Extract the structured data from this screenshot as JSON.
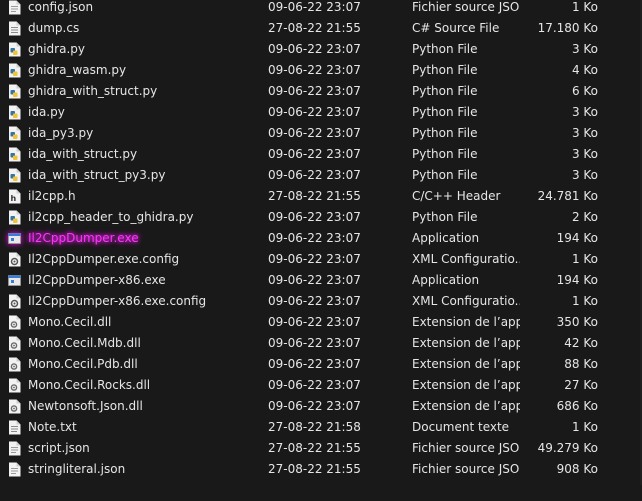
{
  "files": [
    {
      "name": "config.json",
      "date": "09-06-22 23:07",
      "type": "Fichier source JSON",
      "size": "1 Ko",
      "icon": "json-file-icon"
    },
    {
      "name": "dump.cs",
      "date": "27-08-22 21:55",
      "type": "C# Source File",
      "size": "17.180 Ko",
      "icon": "csharp-file-icon"
    },
    {
      "name": "ghidra.py",
      "date": "09-06-22 23:07",
      "type": "Python File",
      "size": "3 Ko",
      "icon": "python-file-icon"
    },
    {
      "name": "ghidra_wasm.py",
      "date": "09-06-22 23:07",
      "type": "Python File",
      "size": "4 Ko",
      "icon": "python-file-icon"
    },
    {
      "name": "ghidra_with_struct.py",
      "date": "09-06-22 23:07",
      "type": "Python File",
      "size": "6 Ko",
      "icon": "python-file-icon"
    },
    {
      "name": "ida.py",
      "date": "09-06-22 23:07",
      "type": "Python File",
      "size": "3 Ko",
      "icon": "python-file-icon"
    },
    {
      "name": "ida_py3.py",
      "date": "09-06-22 23:07",
      "type": "Python File",
      "size": "3 Ko",
      "icon": "python-file-icon"
    },
    {
      "name": "ida_with_struct.py",
      "date": "09-06-22 23:07",
      "type": "Python File",
      "size": "3 Ko",
      "icon": "python-file-icon"
    },
    {
      "name": "ida_with_struct_py3.py",
      "date": "09-06-22 23:07",
      "type": "Python File",
      "size": "3 Ko",
      "icon": "python-file-icon"
    },
    {
      "name": "il2cpp.h",
      "date": "27-08-22 21:55",
      "type": "C/C++ Header",
      "size": "24.781 Ko",
      "icon": "header-file-icon"
    },
    {
      "name": "il2cpp_header_to_ghidra.py",
      "date": "09-06-22 23:07",
      "type": "Python File",
      "size": "2 Ko",
      "icon": "python-file-icon"
    },
    {
      "name": "Il2CppDumper.exe",
      "date": "09-06-22 23:07",
      "type": "Application",
      "size": "194 Ko",
      "icon": "application-icon",
      "highlighted": true
    },
    {
      "name": "Il2CppDumper.exe.config",
      "date": "09-06-22 23:07",
      "type": "XML Configuratio...",
      "size": "1 Ko",
      "icon": "config-file-icon"
    },
    {
      "name": "Il2CppDumper-x86.exe",
      "date": "09-06-22 23:07",
      "type": "Application",
      "size": "194 Ko",
      "icon": "application-icon"
    },
    {
      "name": "Il2CppDumper-x86.exe.config",
      "date": "09-06-22 23:07",
      "type": "XML Configuratio...",
      "size": "1 Ko",
      "icon": "config-file-icon"
    },
    {
      "name": "Mono.Cecil.dll",
      "date": "09-06-22 23:07",
      "type": "Extension de l’app...",
      "size": "350 Ko",
      "icon": "dll-file-icon"
    },
    {
      "name": "Mono.Cecil.Mdb.dll",
      "date": "09-06-22 23:07",
      "type": "Extension de l’app...",
      "size": "42 Ko",
      "icon": "dll-file-icon"
    },
    {
      "name": "Mono.Cecil.Pdb.dll",
      "date": "09-06-22 23:07",
      "type": "Extension de l’app...",
      "size": "88 Ko",
      "icon": "dll-file-icon"
    },
    {
      "name": "Mono.Cecil.Rocks.dll",
      "date": "09-06-22 23:07",
      "type": "Extension de l’app...",
      "size": "27 Ko",
      "icon": "dll-file-icon"
    },
    {
      "name": "Newtonsoft.Json.dll",
      "date": "09-06-22 23:07",
      "type": "Extension de l’app...",
      "size": "686 Ko",
      "icon": "dll-file-icon"
    },
    {
      "name": "Note.txt",
      "date": "27-08-22 21:58",
      "type": "Document texte",
      "size": "1 Ko",
      "icon": "text-file-icon"
    },
    {
      "name": "script.json",
      "date": "27-08-22 21:55",
      "type": "Fichier source JSON",
      "size": "49.279 Ko",
      "icon": "json-file-icon"
    },
    {
      "name": "stringliteral.json",
      "date": "27-08-22 21:55",
      "type": "Fichier source JSON",
      "size": "908 Ko",
      "icon": "json-file-icon"
    }
  ],
  "colors": {
    "background": "#191919",
    "text": "#e6e6e6",
    "highlight": "#ff33ff"
  }
}
